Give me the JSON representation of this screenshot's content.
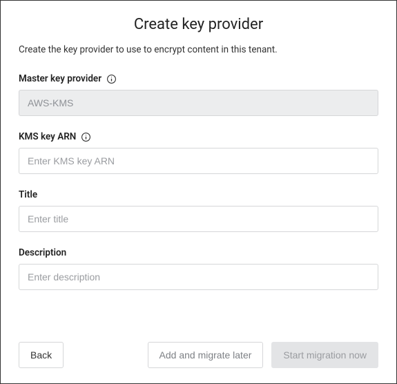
{
  "dialog": {
    "title": "Create key provider",
    "subtitle": "Create the key provider to use to encrypt content in this tenant."
  },
  "fields": {
    "provider": {
      "label": "Master key provider",
      "value": "AWS-KMS"
    },
    "arn": {
      "label": "KMS key ARN",
      "placeholder": "Enter KMS key ARN"
    },
    "title": {
      "label": "Title",
      "placeholder": "Enter title"
    },
    "description": {
      "label": "Description",
      "placeholder": "Enter description"
    }
  },
  "buttons": {
    "back": "Back",
    "add_later": "Add and migrate later",
    "start_now": "Start migration now"
  }
}
